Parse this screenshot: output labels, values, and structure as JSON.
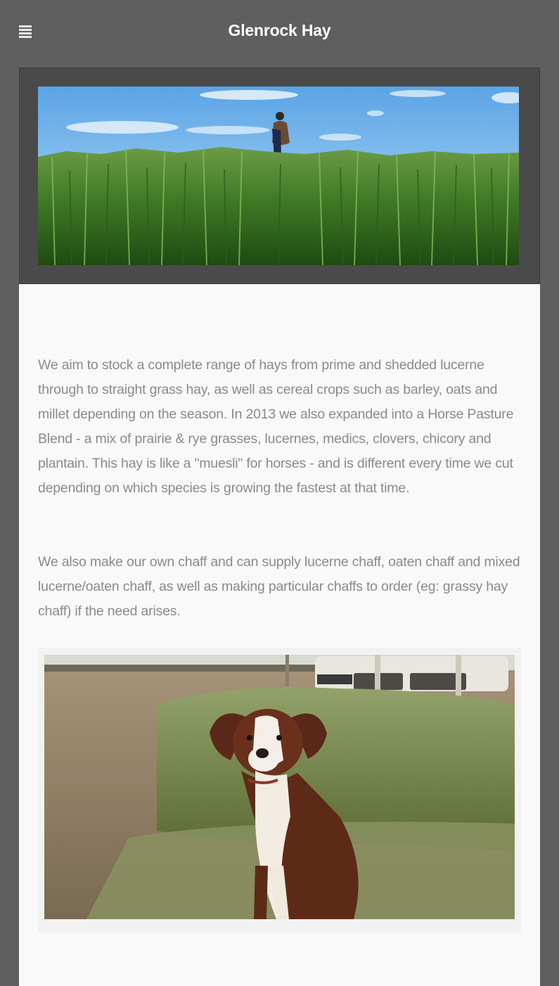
{
  "header": {
    "menu_icon": "hamburger-menu-icon",
    "title": "Glenrock Hay"
  },
  "banner": {
    "image": "farmer-in-cereal-crop-field-photo"
  },
  "content": {
    "paragraphs": [
      "We aim to stock a complete range of hays from prime and shedded lucerne through to straight grass hay, as well as cereal crops such as barley, oats and millet depending on the season. In 2013 we also expanded into a Horse Pasture Blend - a mix of prairie & rye grasses, lucernes, medics, clovers, chicory and plantain.  This hay is like a \"muesli\" for horses - and is different every time we cut depending on which species is growing the fastest at that time.",
      "We also make our own chaff and can supply lucerne chaff, oaten chaff and mixed lucerne/oaten chaff, as well as making particular chaffs to order (eg: grassy hay chaff) if the need arises."
    ],
    "photo": "puppy-sitting-by-hay-bales-photo"
  },
  "colors": {
    "page_background": "#5f5f5f",
    "banner_frame": "#4a4a4a",
    "content_background": "#f9f9f9",
    "body_text": "#8a8a8a",
    "title_text": "#ffffff"
  }
}
